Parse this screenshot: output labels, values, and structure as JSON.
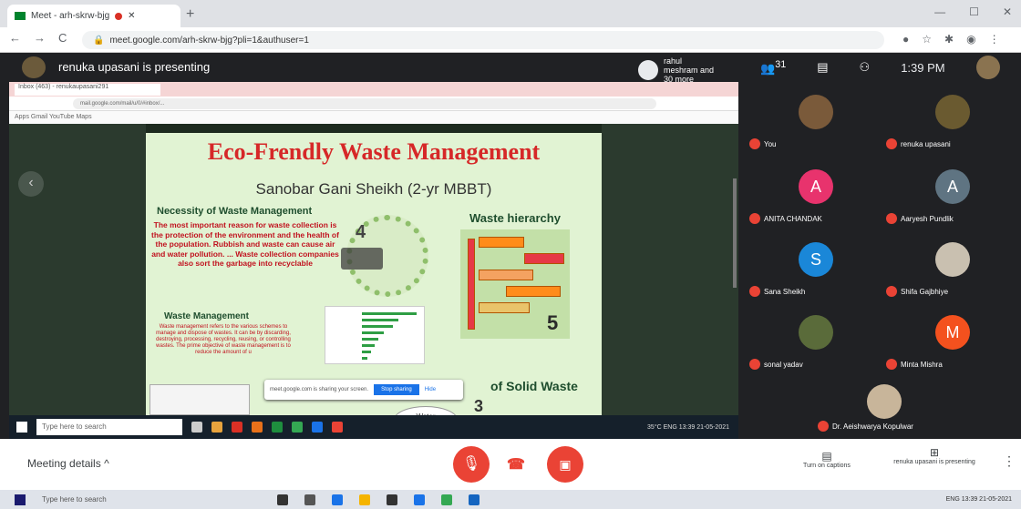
{
  "browser": {
    "tab_title": "Meet - arh-skrw-bjg",
    "url": "meet.google.com/arh-skrw-bjg?pli=1&authuser=1",
    "nav_back": "←",
    "nav_forward": "→",
    "nav_reload": "C",
    "new_tab": "+",
    "minimize": "—",
    "maximize": "☐",
    "close": "✕"
  },
  "meet": {
    "presenter_banner": "renuka upasani is presenting",
    "owner_label": "rahul meshram and 30 more",
    "people_count": "31",
    "clock": "1:39 PM",
    "self_label": "You"
  },
  "shared_screen": {
    "tab_title": "Inbox (463) - renukaupasani291",
    "url": "mail.google.com/mail/u/0/#inbox/...",
    "bookmarks": "Apps  Gmail  YouTube  Maps",
    "slide": {
      "title": "Eco-Frendly Waste Management",
      "author": "Sanobar Gani Sheikh (2-yr MBBT)",
      "heading_necessity": "Necessity of Waste Management",
      "necessity_text": "The most important reason for waste collection is the protection of the environment and the health of the population. Rubbish and waste can cause air and water pollution. ... Waste collection companies also sort the garbage into recyclable",
      "heading_waste_mgmt": "Waste Management",
      "waste_mgmt_text": "Waste management refers to the various schemes to manage and dispose of wastes. It can be by discarding, destroying, processing, recycling, reusing, or controlling wastes. The prime objective of waste management is to reduce the amount of u",
      "heading_hierarchy": "Waste hierarchy",
      "heading_solid": "of Solid Waste",
      "recycle_number": "4",
      "hier_number": "5",
      "num3": "3",
      "water_label": "Water"
    },
    "share_notice": "meet.google.com is sharing your screen.",
    "stop_sharing": "Stop sharing",
    "hide": "Hide",
    "taskbar_search": "Type here to search",
    "taskbar_tray": "35°C  ENG 13:39 21-05-2021"
  },
  "participants": [
    {
      "name": "You",
      "initial": "",
      "color": "#7a5a3a"
    },
    {
      "name": "renuka upasani",
      "initial": "",
      "color": "#6a5a30"
    },
    {
      "name": "ANITA CHANDAK",
      "initial": "A",
      "color": "#e8336d"
    },
    {
      "name": "Aaryesh Pundlik",
      "initial": "A",
      "color": "#5f7482"
    },
    {
      "name": "Sana Sheikh",
      "initial": "S",
      "color": "#1a87d8"
    },
    {
      "name": "Shifa Gajbhiye",
      "initial": "",
      "color": "#c9c0b0"
    },
    {
      "name": "sonal yadav",
      "initial": "",
      "color": "#5a6b3a"
    },
    {
      "name": "Minta Mishra",
      "initial": "M",
      "color": "#f4511e"
    },
    {
      "name": "Dr. Aeishwarya Kopulwar",
      "initial": "",
      "color": "#c8b59a"
    }
  ],
  "bottom": {
    "meeting_details": "Meeting details",
    "chevron": "^",
    "captions": "Turn on captions",
    "presenting": "renuka upasani is presenting",
    "more": "⋮"
  },
  "outer_taskbar": {
    "search": "Type here to search",
    "tray": "ENG 13:39 21-05-2021"
  }
}
